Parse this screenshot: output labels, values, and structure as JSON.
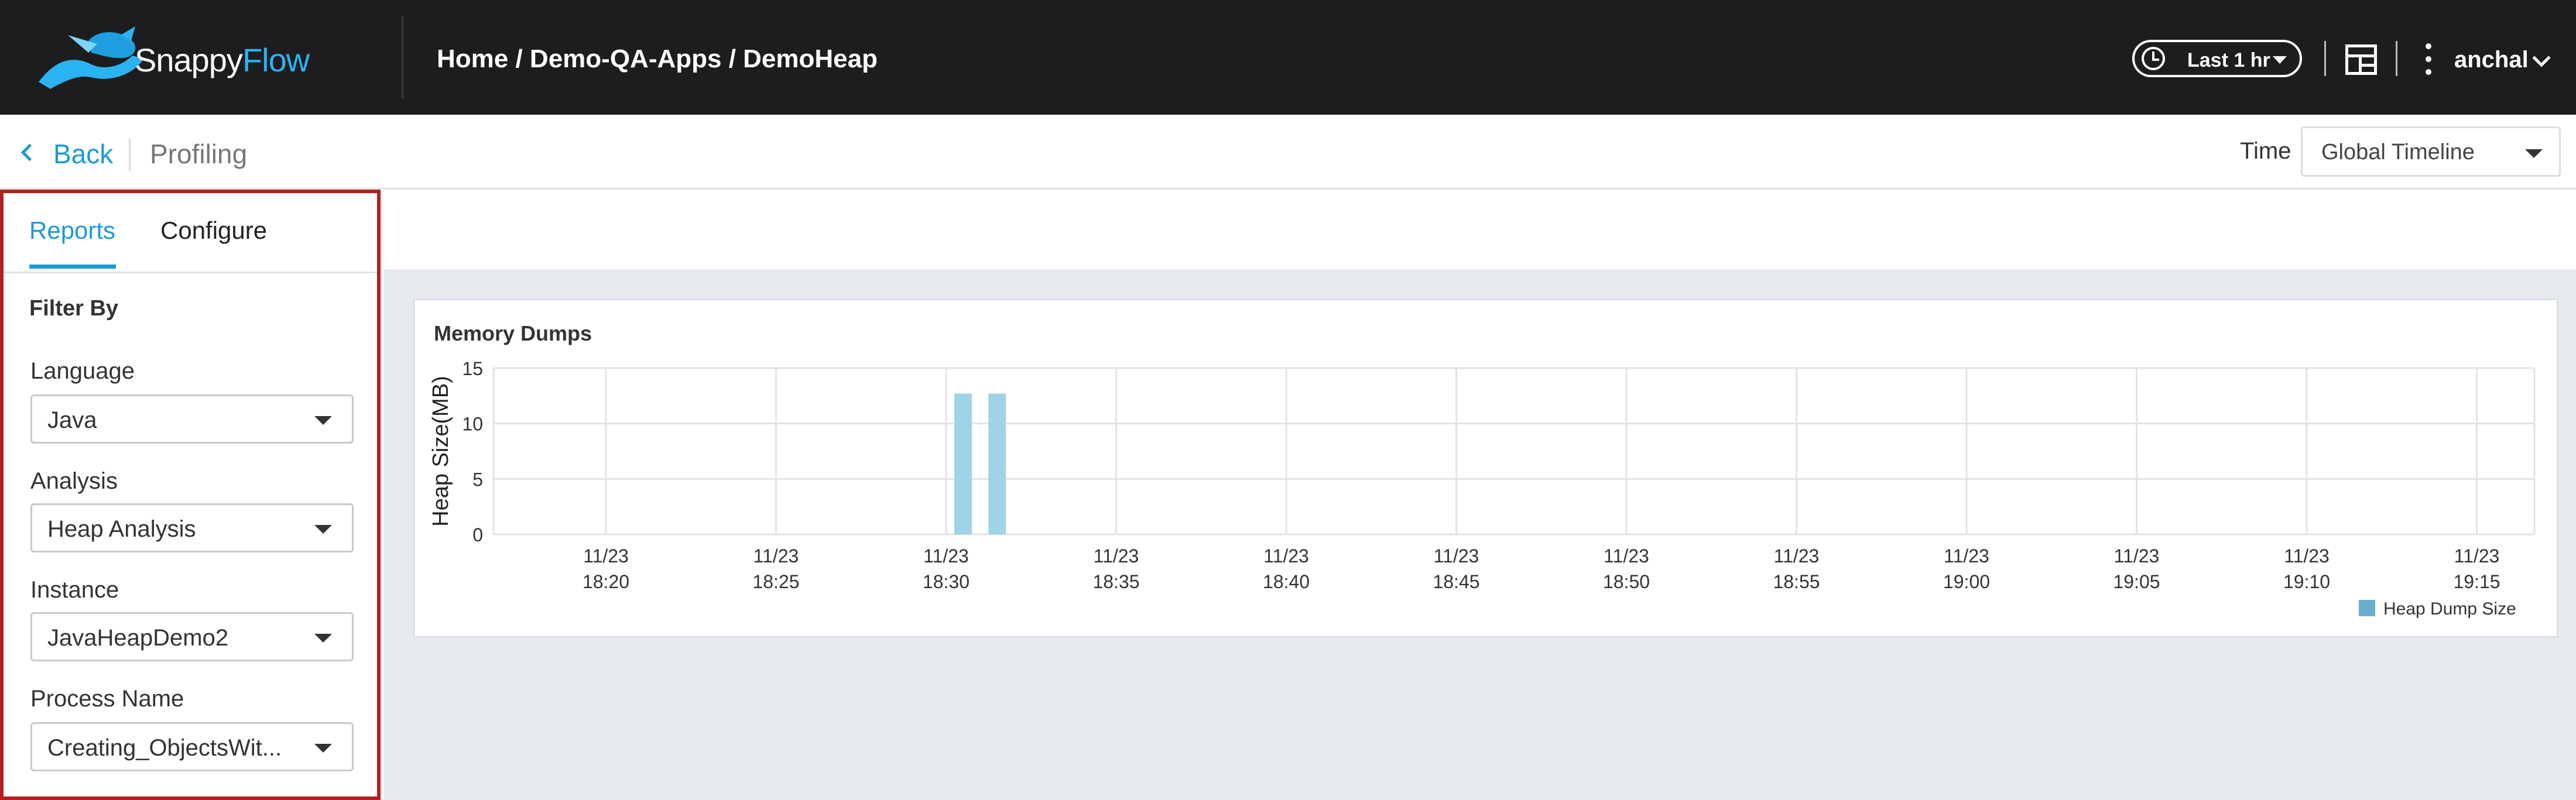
{
  "header": {
    "brand_part1": "Snappy",
    "brand_part2": "Flow",
    "breadcrumb": "Home / Demo-QA-Apps / DemoHeap",
    "time_range": "Last 1 hr",
    "user": "anchal",
    "brand_color": "#2ab3f0"
  },
  "subheader": {
    "back_label": "Back",
    "page_title": "Profiling",
    "time_label": "Time",
    "timeline_value": "Global Timeline"
  },
  "sidebar": {
    "tabs": [
      {
        "label": "Reports",
        "active": true
      },
      {
        "label": "Configure",
        "active": false
      }
    ],
    "filter_heading": "Filter By",
    "filters": [
      {
        "label": "Language",
        "value": "Java"
      },
      {
        "label": "Analysis",
        "value": "Heap Analysis"
      },
      {
        "label": "Instance",
        "value": "JavaHeapDemo2"
      },
      {
        "label": "Process Name",
        "value": "Creating_ObjectsWit..."
      }
    ]
  },
  "chart_data": {
    "type": "bar",
    "title": "Memory Dumps",
    "ylabel": "Heap Size(MB)",
    "xlabel": "",
    "ylim": [
      0,
      15
    ],
    "yticks": [
      0,
      5,
      10,
      15
    ],
    "x_ticks": [
      {
        "date": "11/23",
        "time": "18:20"
      },
      {
        "date": "11/23",
        "time": "18:25"
      },
      {
        "date": "11/23",
        "time": "18:30"
      },
      {
        "date": "11/23",
        "time": "18:35"
      },
      {
        "date": "11/23",
        "time": "18:40"
      },
      {
        "date": "11/23",
        "time": "18:45"
      },
      {
        "date": "11/23",
        "time": "18:50"
      },
      {
        "date": "11/23",
        "time": "18:55"
      },
      {
        "date": "11/23",
        "time": "19:00"
      },
      {
        "date": "11/23",
        "time": "19:05"
      },
      {
        "date": "11/23",
        "time": "19:10"
      },
      {
        "date": "11/23",
        "time": "19:15"
      }
    ],
    "series": [
      {
        "name": "Heap Dump Size",
        "color": "#9fd3e8",
        "legend_color": "#6aaecb",
        "points": [
          {
            "x": "18:30:30",
            "y": 12.7
          },
          {
            "x": "18:31:30",
            "y": 12.7
          }
        ]
      }
    ],
    "grid": true,
    "legend_position": "bottom-right"
  }
}
